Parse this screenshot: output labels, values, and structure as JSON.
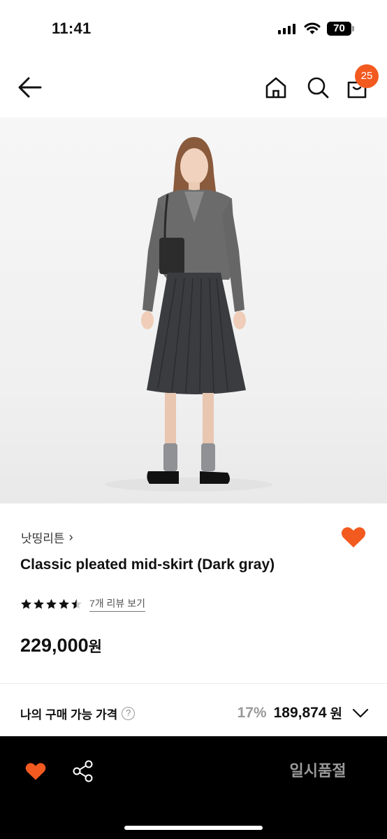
{
  "status_bar": {
    "time": "11:41",
    "battery": "70",
    "icons": [
      "signal-icon",
      "wifi-icon",
      "battery-icon"
    ]
  },
  "nav": {
    "icons": [
      "back-arrow-icon",
      "home-icon",
      "search-icon",
      "shopping-bag-icon"
    ],
    "cart_count": "25"
  },
  "product": {
    "brand": "낫띵리튼",
    "brand_chevron": "›",
    "title": "Classic pleated mid-skirt (Dark gray)",
    "rating": 4.5,
    "rating_max": 5,
    "review_link": "7개 리뷰 보기",
    "price": "229,000",
    "price_unit": "원",
    "wishlisted": true
  },
  "my_price": {
    "label": "나의 구매 가능 가격",
    "help_symbol": "?",
    "discount": "17%",
    "price": "189,874",
    "unit": "원"
  },
  "bottom_bar": {
    "icons": [
      "heart-icon",
      "share-icon"
    ],
    "soldout_label": "일시품절"
  },
  "colors": {
    "accent": "#f35a1f",
    "bottom_bar_bg": "#000000",
    "soldout_text": "#9a9a9a",
    "discount_text": "#999999"
  }
}
